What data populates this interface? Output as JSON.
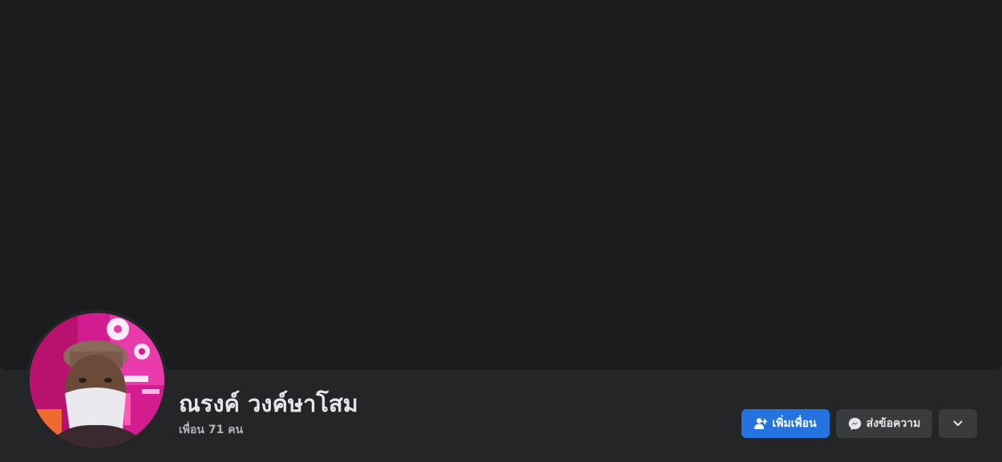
{
  "colors": {
    "background": "#242526",
    "cover": "#1b1c1e",
    "primary_button": "#2374e1",
    "secondary_button": "#3a3b3c",
    "text_primary": "#e4e6eb",
    "text_secondary": "#b0b3b8"
  },
  "profile": {
    "name": "ณรงค์ วงค์ษาโสม",
    "friends_count": "เพื่อน 71 คน",
    "avatar": "profile-photo-man-with-cap-and-face-mask"
  },
  "actions": {
    "add_friend": {
      "label": "เพิ่มเพื่อน",
      "icon": "add-friend-icon"
    },
    "message": {
      "label": "ส่งข้อความ",
      "icon": "messenger-icon"
    },
    "more": {
      "icon": "chevron-down-icon"
    }
  }
}
